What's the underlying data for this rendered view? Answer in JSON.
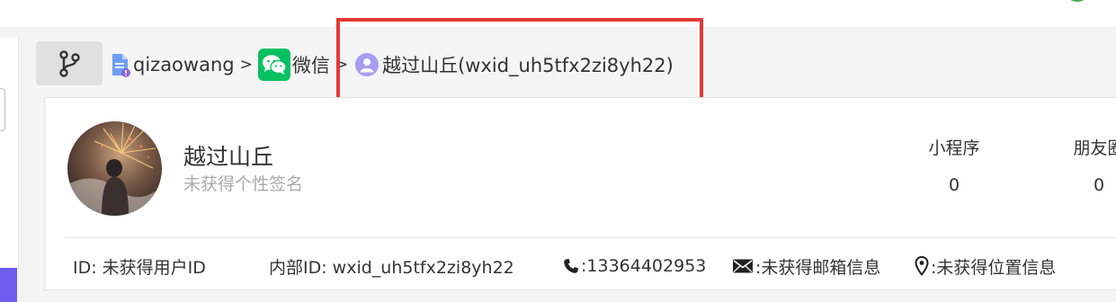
{
  "breadcrumb": {
    "items": [
      {
        "label": "qizaowang",
        "icon": "document-icon"
      },
      {
        "label": "微信",
        "icon": "wechat-icon"
      },
      {
        "label": "越过山丘(wxid_uh5tfx2zi8yh22)",
        "icon": "user-circle-icon"
      }
    ],
    "separator": ">"
  },
  "profile": {
    "nickname": "越过山丘",
    "signature": "未获得个性签名"
  },
  "stats": [
    {
      "label": "小程序",
      "value": "0"
    },
    {
      "label": "朋友圈",
      "value": "0"
    }
  ],
  "info": {
    "id": "ID: 未获得用户ID",
    "internal_id": "内部ID: wxid_uh5tfx2zi8yh22",
    "phone": ":13364402953",
    "email": ":未获得邮箱信息",
    "location": ":未获得位置信息"
  },
  "colors": {
    "highlight": "#e53935",
    "wechat_green": "#07c160",
    "user_icon": "#a89cf4",
    "accent_purple": "#6f5cf1"
  }
}
